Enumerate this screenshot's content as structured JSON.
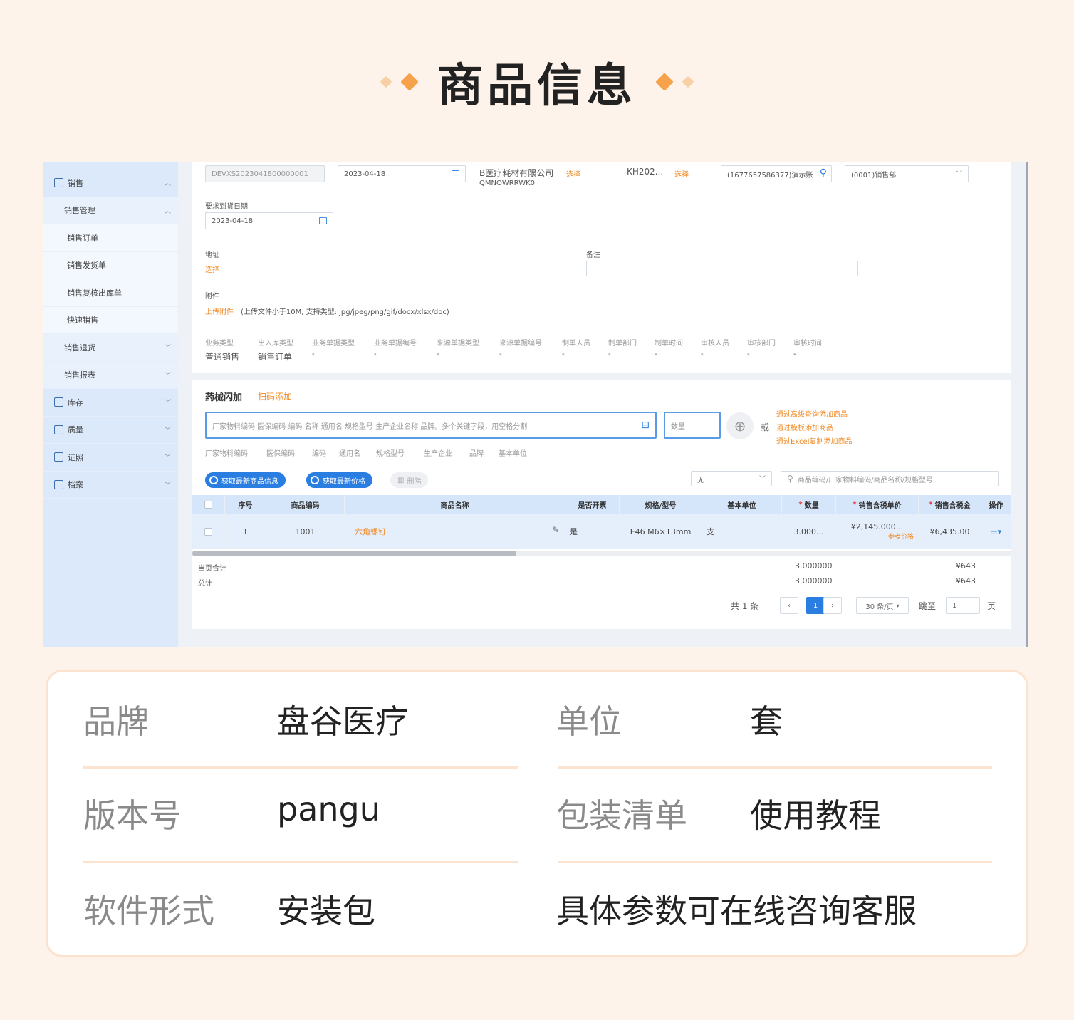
{
  "header": {
    "title": "商品信息"
  },
  "sidebar": {
    "items": [
      {
        "label": "销售",
        "level": 0,
        "icon": "receipt-icon",
        "caret": "^"
      },
      {
        "label": "销售管理",
        "level": 1,
        "caret": "^"
      },
      {
        "label": "销售订单",
        "level": 2
      },
      {
        "label": "销售发货单",
        "level": 2
      },
      {
        "label": "销售复核出库单",
        "level": 2
      },
      {
        "label": "快速销售",
        "level": 2
      },
      {
        "label": "销售退货",
        "level": 1,
        "caret": "v"
      },
      {
        "label": "销售报表",
        "level": 1,
        "caret": "v"
      },
      {
        "label": "库存",
        "level": 0,
        "icon": "warehouse-icon",
        "caret": "v"
      },
      {
        "label": "质量",
        "level": 0,
        "icon": "clipboard-icon",
        "caret": "v"
      },
      {
        "label": "证照",
        "level": 0,
        "icon": "license-icon",
        "caret": "v"
      },
      {
        "label": "档案",
        "level": 0,
        "icon": "folder-icon",
        "caret": "v"
      }
    ]
  },
  "form": {
    "order_no": "DEVXS2023041800000001",
    "order_date": "2023-04-18",
    "customer": "B医疗耗材有限公司",
    "customer_select": "选择",
    "customer_code": "QMNOWRRWK0",
    "contract": "KH202...",
    "contract_select": "选择",
    "account": "(1677657586377)演示账",
    "department": "(0001)销售部",
    "delivery_label": "要求到货日期",
    "delivery_date": "2023-04-18",
    "address_label": "地址",
    "address_select": "选择",
    "remark_label": "备注",
    "attach_label": "附件",
    "attach_link": "上传附件",
    "attach_hint": "(上传文件小于10M, 支持类型: jpg/jpeg/png/gif/docx/xlsx/doc)"
  },
  "meta": {
    "columns": [
      "业务类型",
      "出入库类型",
      "业务单据类型",
      "业务单据编号",
      "来源单据类型",
      "来源单据编号",
      "制单人员",
      "制单部门",
      "制单时间",
      "审核人员",
      "审核部门",
      "审核时间"
    ],
    "values": [
      "普通销售",
      "销售订单",
      "-",
      "-",
      "-",
      "-",
      "-",
      "-",
      "-",
      "-",
      "-",
      "-"
    ]
  },
  "goods": {
    "tab_active": "药械闪加",
    "tab_other": "扫码添加",
    "search_placeholder": "厂家物料编码 医保编码 编码 名称 通用名 规格型号 生产企业名称 品牌。多个关键字段，用空格分割",
    "qty_placeholder": "数量",
    "or_label": "或",
    "links": [
      "通过高级查询添加商品",
      "通过模板添加商品",
      "通过Excel复制添加商品"
    ],
    "hint_fields": [
      "厂家物料编码",
      "医保编码",
      "编码",
      "通用名",
      "规格型号",
      "生产企业",
      "品牌",
      "基本单位"
    ],
    "btn_refresh_info": "获取最新商品信息",
    "btn_refresh_price": "获取最新价格",
    "btn_delete": "删除",
    "filter_value": "无",
    "filter_search_placeholder": "商品编码/厂家物料编码/商品名称/规格型号"
  },
  "table": {
    "headers": [
      "序号",
      "商品编码",
      "商品名称",
      "是否开票",
      "规格/型号",
      "基本单位",
      "数量",
      "销售含税单价",
      "销售含税金",
      "操作"
    ],
    "rows": [
      {
        "index": "1",
        "code": "1001",
        "name": "六角螺钉",
        "invoice": "是",
        "spec": "E46 M6×13mm",
        "unit": "支",
        "qty": "3.000...",
        "price": "¥2,145.000...",
        "price_ref": "参考价格",
        "amount": "¥6,435.00"
      }
    ],
    "page_total_label": "当页合计",
    "total_label": "总计",
    "page_total_qty": "3.000000",
    "total_qty": "3.000000",
    "page_total_amount": "¥643",
    "total_amount": "¥643"
  },
  "pager": {
    "total": "共 1 条",
    "current": "1",
    "page_size": "30 条/页",
    "jump_label": "跳至",
    "jump_value": "1",
    "page_unit": "页"
  },
  "specs": {
    "brand_label": "品牌",
    "brand_value": "盘谷医疗",
    "unit_label": "单位",
    "unit_value": "套",
    "version_label": "版本号",
    "version_value": "pangu",
    "package_label": "包装清单",
    "package_value": "使用教程",
    "form_label": "软件形式",
    "form_value": "安装包",
    "note": "具体参数可在线咨询客服"
  },
  "colors": {
    "accent": "#f5a24b",
    "primary": "#2a7de1",
    "link_orange": "#f08a24"
  }
}
